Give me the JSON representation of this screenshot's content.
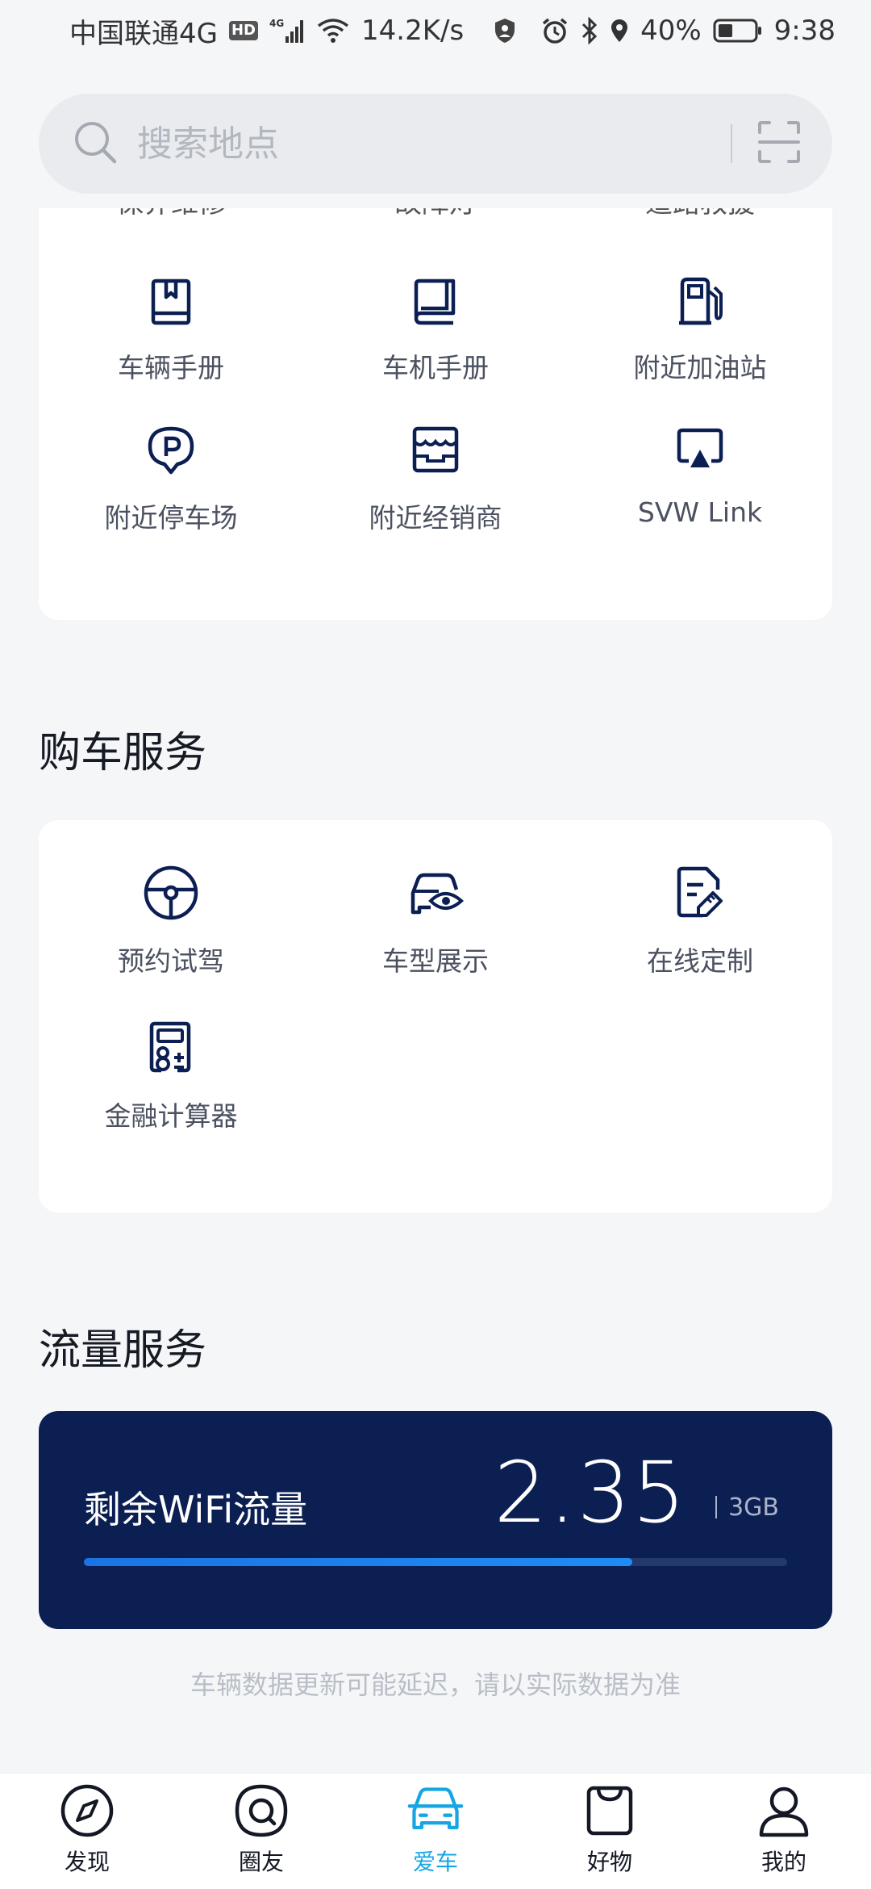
{
  "status_bar": {
    "carrier": "中国联通4G",
    "hd": "HD",
    "net_type": "4G",
    "speed": "14.2K/s",
    "battery": "40%",
    "time": "9:38"
  },
  "search": {
    "placeholder": "搜索地点"
  },
  "top_card": {
    "cut_labels": [
      "保养维修",
      "故障灯",
      "道路救援"
    ],
    "items": [
      {
        "label": "车辆手册",
        "icon": "book-icon"
      },
      {
        "label": "车机手册",
        "icon": "manual-icon"
      },
      {
        "label": "附近加油站",
        "icon": "gas-station-icon"
      },
      {
        "label": "附近停车场",
        "icon": "parking-icon"
      },
      {
        "label": "附近经销商",
        "icon": "store-icon"
      },
      {
        "label": "SVW Link",
        "icon": "screen-cast-icon"
      }
    ]
  },
  "buy_section": {
    "title": "购车服务",
    "items": [
      {
        "label": "预约试驾",
        "icon": "steering-wheel-icon"
      },
      {
        "label": "车型展示",
        "icon": "car-view-icon"
      },
      {
        "label": "在线定制",
        "icon": "custom-doc-icon"
      },
      {
        "label": "金融计算器",
        "icon": "calculator-icon"
      }
    ]
  },
  "flow_section": {
    "title": "流量服务",
    "wifi_label": "剩余WiFi流量",
    "wifi_value": "2.35",
    "wifi_unit": "3GB",
    "progress": 0.78
  },
  "notice": "车辆数据更新可能延迟，请以实际数据为准",
  "colors": {
    "accent": "#17a6e3",
    "wifi_card": "#0c1f52",
    "progress": "#1e80ee"
  },
  "bottom_nav": [
    {
      "label": "发现",
      "icon": "compass-icon",
      "active": false
    },
    {
      "label": "圈友",
      "icon": "chat-icon",
      "active": false
    },
    {
      "label": "爱车",
      "icon": "car-icon",
      "active": true
    },
    {
      "label": "好物",
      "icon": "shop-icon",
      "active": false
    },
    {
      "label": "我的",
      "icon": "user-icon",
      "active": false
    }
  ]
}
